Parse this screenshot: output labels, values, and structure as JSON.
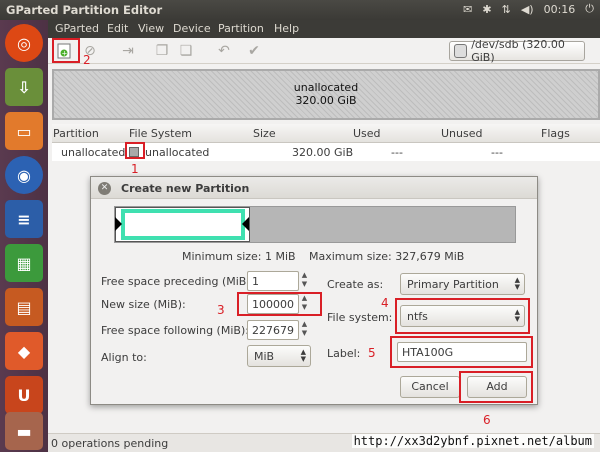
{
  "window": {
    "title": "GParted Partition Editor"
  },
  "topbar": {
    "clock": "00:16",
    "tray_icons": [
      "mail-icon",
      "bluetooth-icon",
      "network-icon",
      "volume-icon",
      "power-icon"
    ]
  },
  "menu": [
    "GParted",
    "Edit",
    "View",
    "Device",
    "Partition",
    "Help"
  ],
  "device": {
    "label": "/dev/sdb  (320.00 GiB)"
  },
  "graph": {
    "line1": "unallocated",
    "line2": "320.00 GiB"
  },
  "table": {
    "headers": [
      "Partition",
      "File System",
      "Size",
      "Used",
      "Unused",
      "Flags"
    ],
    "row": {
      "partition": "unallocated",
      "fs": "unallocated",
      "size": "320.00 GiB",
      "used": "---",
      "unused": "---",
      "flags": ""
    }
  },
  "dialog": {
    "title": "Create new Partition",
    "min_size": "Minimum size: 1 MiB",
    "max_size": "Maximum size: 327,679 MiB",
    "free_preceding_label": "Free space preceding (MiB):",
    "free_preceding_value": "1",
    "new_size_label": "New size (MiB):",
    "new_size_value": "100000",
    "free_following_label": "Free space following (MiB):",
    "free_following_value": "227679",
    "align_label": "Align to:",
    "align_value": "MiB",
    "create_as_label": "Create as:",
    "create_as_value": "Primary Partition",
    "fs_label": "File system:",
    "fs_value": "ntfs",
    "label_label": "Label:",
    "label_value": "HTA100G",
    "cancel": "Cancel",
    "add": "Add"
  },
  "annotations": [
    "1",
    "2",
    "3",
    "4",
    "5",
    "6"
  ],
  "status": {
    "text": "0 operations pending"
  },
  "watermark": "http://xx3d2ybnf.pixnet.net/album",
  "colors": {
    "annotation_red": "#d91f26",
    "resize_green": "#3fe0b0"
  }
}
